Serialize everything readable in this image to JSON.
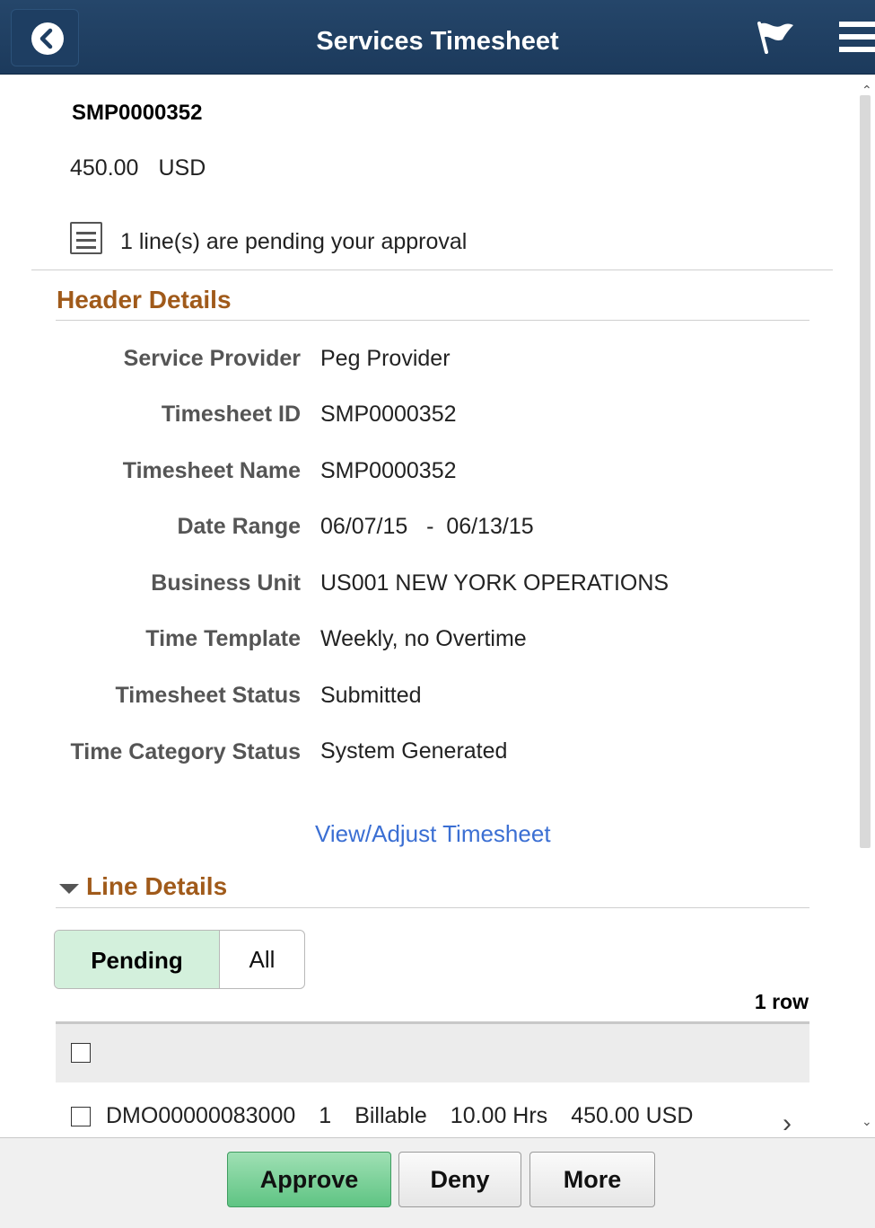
{
  "header": {
    "title": "Services Timesheet"
  },
  "summary": {
    "id": "SMP0000352",
    "amount": "450.00",
    "currency": "USD",
    "pending_text": "1 line(s) are pending your approval"
  },
  "header_details": {
    "title": "Header Details",
    "fields": [
      {
        "label": "Service Provider",
        "value": "Peg Provider"
      },
      {
        "label": "Timesheet ID",
        "value": "SMP0000352"
      },
      {
        "label": "Timesheet Name",
        "value": "SMP0000352"
      },
      {
        "label": "Date Range",
        "value": "06/07/15   -  06/13/15"
      },
      {
        "label": "Business Unit",
        "value": "US001 NEW YORK OPERATIONS"
      },
      {
        "label": "Time Template",
        "value": "Weekly, no Overtime"
      },
      {
        "label": "Timesheet Status",
        "value": "Submitted"
      },
      {
        "label": "Time Category Status",
        "value": "System Generated"
      }
    ],
    "link": "View/Adjust Timesheet"
  },
  "line_details": {
    "title": "Line Details",
    "tabs": [
      "Pending",
      "All"
    ],
    "row_count": "1 row",
    "rows": [
      {
        "line_id": "DMO00000083000",
        "num": "1",
        "type": "Billable",
        "hours": "10.00 Hrs",
        "amount": "450.00 USD"
      }
    ]
  },
  "footer": {
    "approve": "Approve",
    "deny": "Deny",
    "more": "More"
  },
  "colors": {
    "header_bg": "#25466a",
    "section_title": "#a05a1a",
    "link": "#3b6fd3",
    "approve_btn": "#5fc483",
    "pending_tab": "#d3f0dc"
  }
}
